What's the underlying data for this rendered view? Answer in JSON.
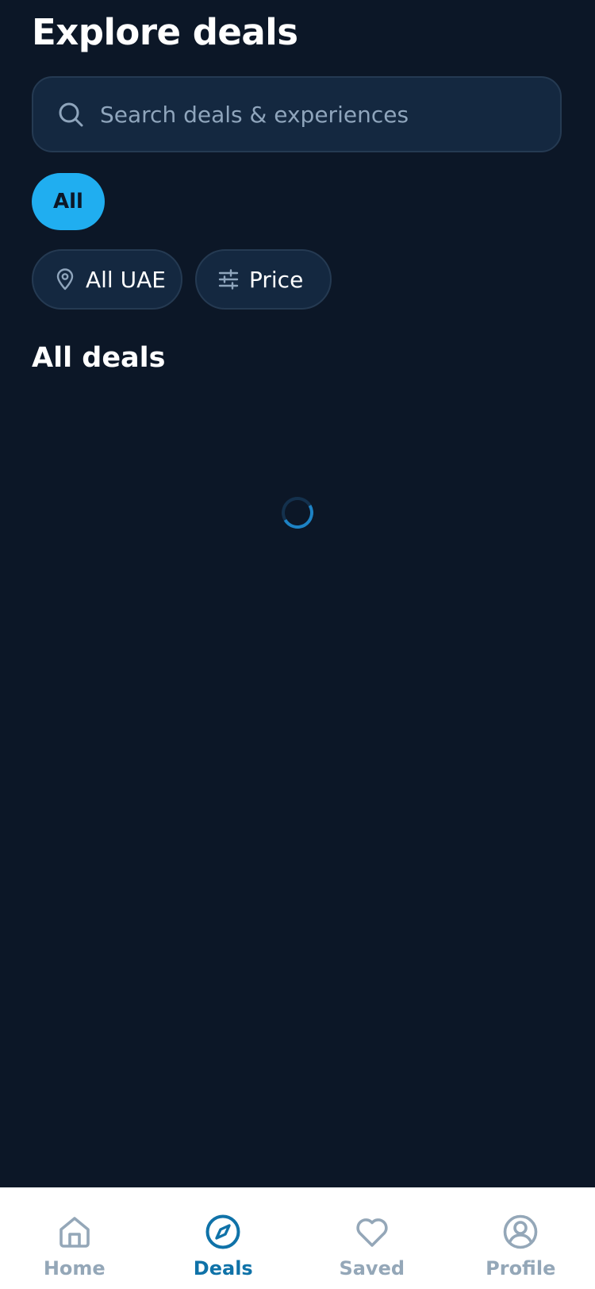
{
  "header": {
    "title": "Explore deals"
  },
  "search": {
    "placeholder": "Search deals & experiences",
    "value": "",
    "icon": "search-icon"
  },
  "categories": {
    "items": [
      {
        "label": "All",
        "selected": true
      }
    ]
  },
  "filters": {
    "location": {
      "label": "All UAE",
      "icon": "map-pin-icon"
    },
    "price": {
      "label": "Price",
      "icon": "sliders-icon"
    }
  },
  "section": {
    "title": "All deals",
    "loading": true
  },
  "nav": {
    "items": [
      {
        "label": "Home",
        "icon": "home-icon",
        "active": false
      },
      {
        "label": "Deals",
        "icon": "compass-icon",
        "active": true
      },
      {
        "label": "Saved",
        "icon": "heart-icon",
        "active": false
      },
      {
        "label": "Profile",
        "icon": "user-circle-icon",
        "active": false
      }
    ]
  },
  "colors": {
    "background": "#0c1727",
    "surface": "#142840",
    "border": "#253a52",
    "accent": "#20aef0",
    "nav_active": "#0f72a8",
    "nav_inactive": "#94a7b8",
    "placeholder": "#8fa5bc"
  }
}
